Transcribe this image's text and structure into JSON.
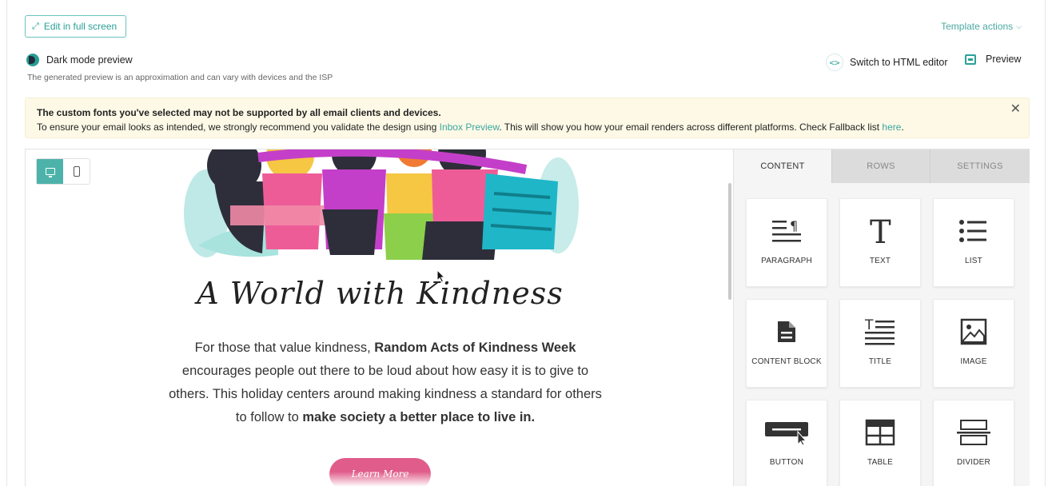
{
  "toolbar": {
    "fullscreen_label": "Edit in full screen",
    "template_actions_label": "Template actions",
    "dark_mode_label": "Dark mode preview",
    "dark_mode_note": "The generated preview is an approximation and can vary with devices and the ISP",
    "html_editor_label": "Switch to HTML editor",
    "preview_label": "Preview"
  },
  "banner": {
    "title": "The custom fonts you've selected may not be supported by all email clients and devices.",
    "text_before": "To ensure your email looks as intended, we strongly recommend you validate the design using ",
    "inbox_link": "Inbox Preview",
    "text_middle": ". This will show you how your email renders across different platforms. Check Fallback list ",
    "here_link": "here",
    "text_after": "."
  },
  "canvas": {
    "title": "A World with Kindness",
    "copy_1": "For those that value kindness, ",
    "copy_bold_1": "Random Acts of Kindness Week",
    "copy_2": " encourages people out there to be loud about how easy it is to give to others. This holiday centers around making kindness a standard for others to follow to ",
    "copy_bold_2": "make society a better place to live in.",
    "button_label": "Learn More"
  },
  "panel": {
    "tabs": [
      {
        "label": "CONTENT",
        "active": true
      },
      {
        "label": "ROWS",
        "active": false
      },
      {
        "label": "SETTINGS",
        "active": false
      }
    ],
    "tiles": [
      {
        "label": "PARAGRAPH",
        "icon": "paragraph-icon"
      },
      {
        "label": "TEXT",
        "icon": "text-icon"
      },
      {
        "label": "LIST",
        "icon": "list-icon"
      },
      {
        "label": "CONTENT BLOCK",
        "icon": "content-block-icon"
      },
      {
        "label": "TITLE",
        "icon": "title-icon"
      },
      {
        "label": "IMAGE",
        "icon": "image-icon"
      },
      {
        "label": "BUTTON",
        "icon": "button-icon"
      },
      {
        "label": "TABLE",
        "icon": "table-icon"
      },
      {
        "label": "DIVIDER",
        "icon": "divider-icon"
      }
    ]
  },
  "colors": {
    "accent": "#2aa198",
    "banner_bg": "#fdf9e6",
    "cta": "#e05c8a"
  }
}
